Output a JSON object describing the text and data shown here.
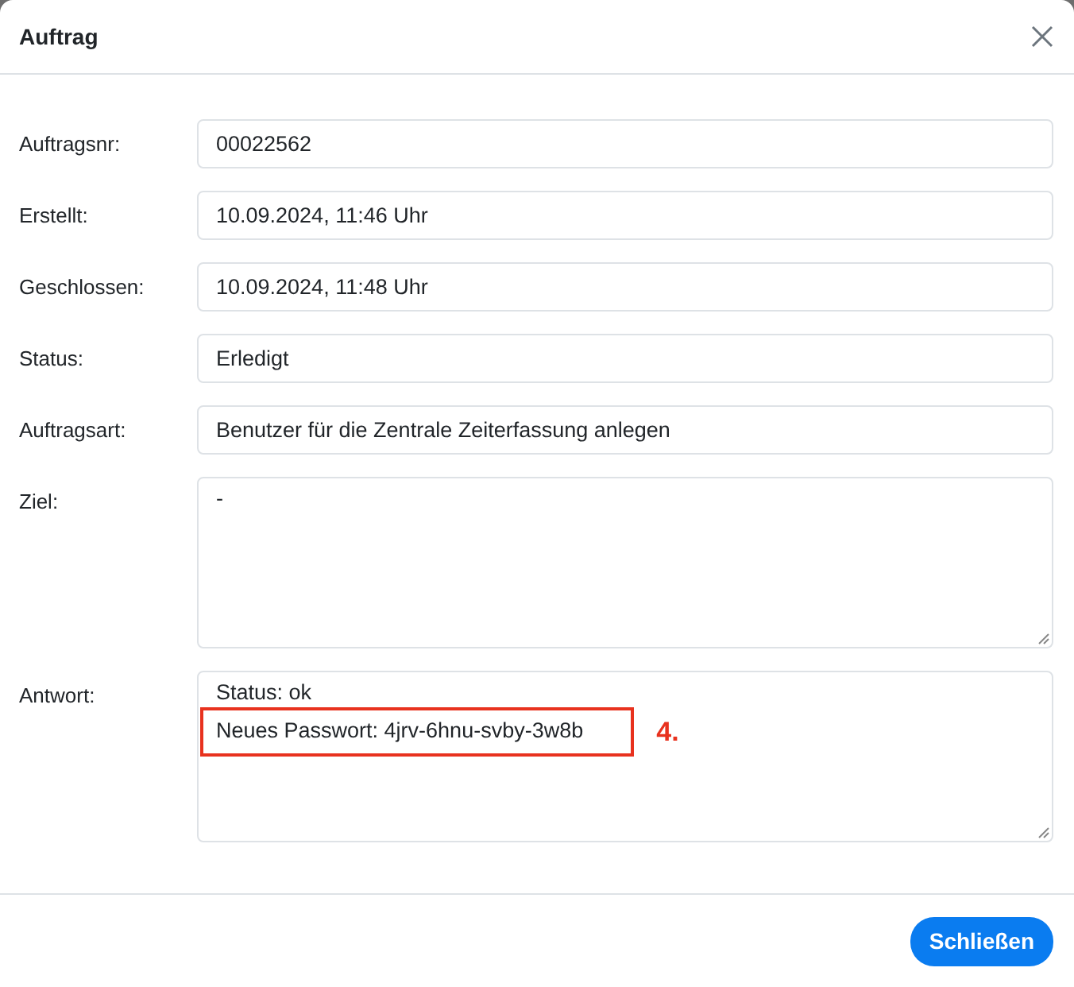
{
  "dialog": {
    "title": "Auftrag"
  },
  "fields": [
    {
      "label": "Auftragsnr:",
      "kind": "input",
      "value": "00022562"
    },
    {
      "label": "Erstellt:",
      "kind": "input",
      "value": "10.09.2024, 11:46 Uhr"
    },
    {
      "label": "Geschlossen:",
      "kind": "input",
      "value": "10.09.2024, 11:48 Uhr"
    },
    {
      "label": "Status:",
      "kind": "input",
      "value": "Erledigt"
    },
    {
      "label": "Auftragsart:",
      "kind": "input",
      "value": "Benutzer für die Zentrale Zeiterfassung anlegen"
    },
    {
      "label": "Ziel:",
      "kind": "textarea",
      "lines": [
        {
          "text": "-",
          "highlighted": false
        }
      ]
    },
    {
      "label": "Antwort:",
      "kind": "textarea",
      "lines": [
        {
          "text": "Status: ok",
          "highlighted": false
        },
        {
          "text": "Neues Passwort: 4jrv-6hnu-svby-3w8b",
          "highlighted": true,
          "annotation": "4."
        }
      ]
    }
  ],
  "buttons": [
    {
      "label": "Schließen"
    }
  ]
}
